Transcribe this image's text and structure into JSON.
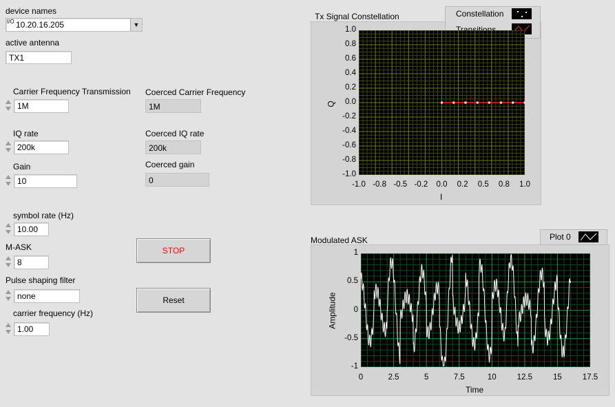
{
  "device": {
    "label": "device names",
    "io_glyph": "I/O",
    "value": "10.20.16.205",
    "dropdown": "▼"
  },
  "antenna": {
    "label": "active antenna",
    "value": "TX1"
  },
  "carrier_tx": {
    "label": "Carrier Frequency Transmission",
    "value": "1M"
  },
  "iq_rate": {
    "label": "IQ rate",
    "value": "200k"
  },
  "gain": {
    "label": "Gain",
    "value": "10"
  },
  "coerced": {
    "carrier_label": "Coerced Carrier Frequency",
    "carrier_value": "1M",
    "iq_label": "Coerced IQ rate",
    "iq_value": "200k",
    "gain_label": "Coerced gain",
    "gain_value": "0"
  },
  "symbol_rate": {
    "label": "symbol rate (Hz)",
    "value": "10.00"
  },
  "mask": {
    "label": "M-ASK",
    "value": "8"
  },
  "pulse": {
    "label": "Pulse shaping filter",
    "value": "none"
  },
  "carrier_hz": {
    "label": "carrier frequency (Hz)",
    "value": "1.00"
  },
  "buttons": {
    "stop": "STOP",
    "reset": "Reset",
    "stop_color": "#ff0000"
  },
  "colors": {
    "background": "#e3e3e3",
    "grid": "#6b7a1f",
    "modgrid": "#1f8a3a",
    "trace": "#ffffff",
    "transition": "#ff2020"
  },
  "constellation": {
    "title": "Tx Signal Constellation",
    "legend": [
      "Constellation",
      "Transitions"
    ],
    "xlabel": "I",
    "ylabel": "Q",
    "x_ticks": [
      "-1.0",
      "-0.8",
      "-0.5",
      "-0.2",
      "0.0",
      "0.2",
      "0.5",
      "0.8",
      "1.0"
    ],
    "y_ticks": [
      "1.0",
      "0.8",
      "0.6",
      "0.4",
      "0.2",
      "0.0",
      "-0.2",
      "-0.4",
      "-0.6",
      "-0.8",
      "-1.0"
    ]
  },
  "modulated": {
    "title": "Modulated ASK",
    "legend": "Plot 0",
    "xlabel": "Time",
    "ylabel": "Amplitude",
    "x_ticks": [
      "0",
      "2.5",
      "5",
      "7.5",
      "10",
      "12.5",
      "15",
      "17.5"
    ],
    "y_ticks": [
      "1",
      "0.5",
      "0",
      "-0.5",
      "-1"
    ]
  },
  "chart_data": [
    {
      "type": "scatter",
      "title": "Tx Signal Constellation",
      "xlabel": "I",
      "ylabel": "Q",
      "xlim": [
        -1.0,
        1.0
      ],
      "ylim": [
        -1.0,
        1.0
      ],
      "grid": true,
      "legend": "top-right",
      "series": [
        {
          "name": "Constellation",
          "x": [
            0.0,
            0.143,
            0.286,
            0.429,
            0.571,
            0.714,
            0.857,
            1.0
          ],
          "y": [
            0,
            0,
            0,
            0,
            0,
            0,
            0,
            0
          ]
        },
        {
          "name": "Transitions",
          "x": [
            0.0,
            1.0
          ],
          "y": [
            0,
            0
          ]
        }
      ]
    },
    {
      "type": "line",
      "title": "Modulated ASK",
      "xlabel": "Time",
      "ylabel": "Amplitude",
      "xlim": [
        0,
        17.5
      ],
      "ylim": [
        -1,
        1
      ],
      "grid": true,
      "legend": "top-right",
      "series": [
        {
          "name": "Plot 0"
        }
      ],
      "symbols": [
        0.55,
        0.35,
        0.85,
        0.25,
        0.7,
        0.4,
        1.0,
        0.3,
        0.6,
        0.8,
        0.45,
        0.9,
        0.2,
        0.65,
        0.5,
        0.75
      ],
      "symbol_rate_hz": 10.0,
      "carrier_hz": 1.0
    }
  ]
}
